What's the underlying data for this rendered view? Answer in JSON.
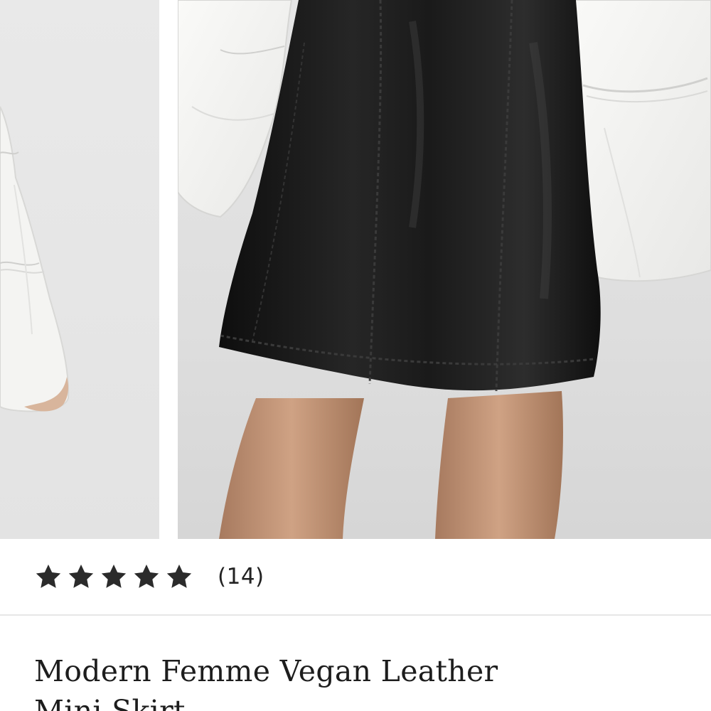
{
  "product": {
    "images": [
      {
        "name": "product-photo-back",
        "alt": "white blouse with ruffled bell sleeves"
      },
      {
        "name": "product-photo-front",
        "alt": "black vegan leather mini skirt"
      }
    ],
    "rating": {
      "stars": 5,
      "max_stars": 5,
      "star_icon": "star-icon",
      "review_count_text": "(14)"
    },
    "title": "Modern Femme Vegan Leather Mini Skirt"
  },
  "colors": {
    "star": "#2b2b2b",
    "title_text": "#1d1d1d",
    "divider": "#e6e6e6",
    "skirt": "#141414",
    "blouse": "#f3f3f1",
    "background": "#e4e4e4"
  }
}
